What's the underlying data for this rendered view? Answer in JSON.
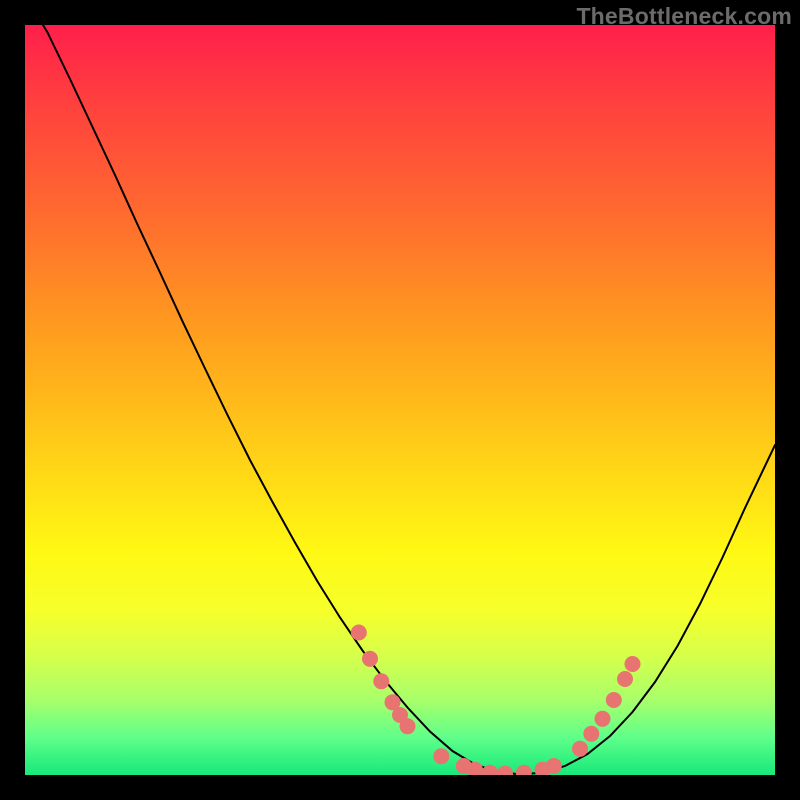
{
  "watermark": "TheBottleneck.com",
  "colors": {
    "curve_stroke": "#000000",
    "marker_fill": "#e77471",
    "background_frame": "#000000"
  },
  "chart_data": {
    "type": "line",
    "title": "",
    "xlabel": "",
    "ylabel": "",
    "xlim": [
      0,
      100
    ],
    "ylim": [
      0,
      100
    ],
    "x": [
      0,
      3,
      6,
      9,
      12,
      15,
      18,
      21,
      24,
      27,
      30,
      33,
      36,
      39,
      42,
      45,
      48,
      51,
      54,
      57,
      60,
      63,
      66,
      69,
      72,
      75,
      78,
      81,
      84,
      87,
      90,
      93,
      96,
      100
    ],
    "values": [
      104,
      99.0,
      92.8,
      86.4,
      80.0,
      73.4,
      67.0,
      60.5,
      54.2,
      48.0,
      42.0,
      36.4,
      31.0,
      25.8,
      21.0,
      16.6,
      12.6,
      9.0,
      5.8,
      3.2,
      1.4,
      0.4,
      0.1,
      0.3,
      1.2,
      2.8,
      5.2,
      8.4,
      12.4,
      17.2,
      22.8,
      29.0,
      35.6,
      44.0
    ],
    "markers": {
      "left_cluster_x": [
        44.5,
        46.0,
        47.5,
        49.0,
        50.0,
        51.0
      ],
      "left_cluster_y": [
        19.0,
        15.5,
        12.5,
        9.7,
        8.0,
        6.5
      ],
      "bottom_cluster_x": [
        55.5,
        58.5,
        60.0,
        62.0,
        64.0,
        66.5,
        69.0,
        70.5
      ],
      "bottom_cluster_y": [
        2.5,
        1.2,
        0.7,
        0.3,
        0.2,
        0.3,
        0.7,
        1.2
      ],
      "right_cluster_x": [
        74.0,
        75.5,
        77.0,
        78.5,
        80.0,
        81.0
      ],
      "right_cluster_y": [
        3.5,
        5.5,
        7.5,
        10.0,
        12.8,
        14.8
      ]
    }
  }
}
